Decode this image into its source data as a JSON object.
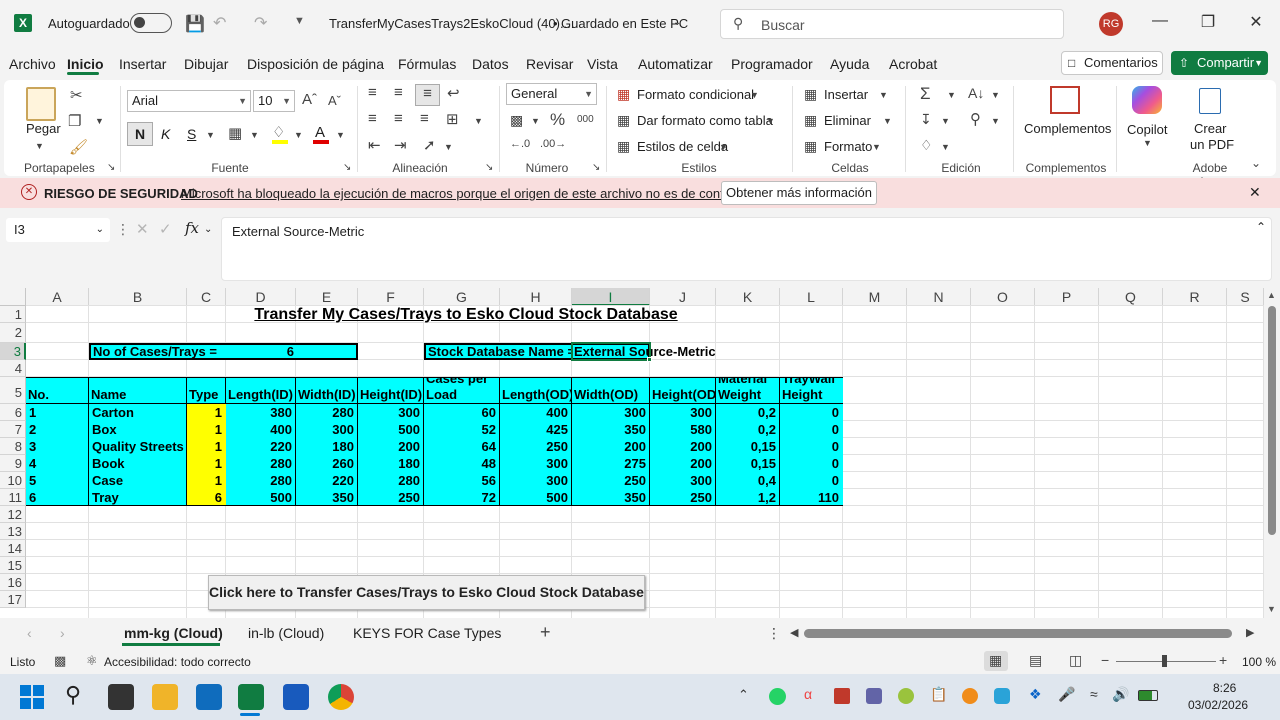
{
  "titlebar": {
    "autosave_label": "Autoguardado",
    "file_title": "TransferMyCasesTrays2EskoCloud (40)....",
    "save_status": "Guardado en Este PC",
    "search_placeholder": "Buscar",
    "user_initials": "RG"
  },
  "menu": {
    "tabs": [
      "Archivo",
      "Inicio",
      "Insertar",
      "Dibujar",
      "Disposición de página",
      "Fórmulas",
      "Datos",
      "Revisar",
      "Vista",
      "Automatizar",
      "Programador",
      "Ayuda",
      "Acrobat"
    ],
    "comments_label": "Comentarios",
    "share_label": "Compartir"
  },
  "ribbon": {
    "paste_label": "Pegar",
    "font_name": "Arial",
    "font_size": "10",
    "bold_label": "N",
    "italic_label": "K",
    "underline_label": "S",
    "number_format": "General",
    "cond_format": "Formato condicional",
    "format_table": "Dar formato como tabla",
    "cell_styles": "Estilos de celda",
    "insert_label": "Insertar",
    "delete_label": "Eliminar",
    "format_label": "Formato",
    "addins_label": "Complementos",
    "copilot_label": "Copilot",
    "create_pdf_line1": "Crear",
    "create_pdf_line2": "un PDF",
    "groups": {
      "clipboard": "Portapapeles",
      "font": "Fuente",
      "alignment": "Alineación",
      "number": "Número",
      "styles": "Estilos",
      "cells": "Celdas",
      "editing": "Edición",
      "addins": "Complementos",
      "adobe": "Adobe Ac..."
    }
  },
  "security": {
    "title": "RIESGO DE SEGURIDAD",
    "message": "Microsoft ha bloqueado la ejecución de macros porque el origen de este archivo no es de confianza.",
    "button": "Obtener más información"
  },
  "formula_bar": {
    "name_box": "I3",
    "fx": "fx",
    "content": "External Source-Metric"
  },
  "sheet": {
    "columns": [
      "A",
      "B",
      "C",
      "D",
      "E",
      "F",
      "G",
      "H",
      "I",
      "J",
      "K",
      "L",
      "M",
      "N",
      "O",
      "P",
      "Q",
      "R",
      "S"
    ],
    "rows": [
      "1",
      "2",
      "3",
      "4",
      "5",
      "6",
      "7",
      "8",
      "9",
      "10",
      "11",
      "12",
      "13",
      "14",
      "15",
      "16",
      "17"
    ],
    "title": "Transfer My Cases/Trays to Esko Cloud Stock Database",
    "cases_label": "No of Cases/Trays =",
    "cases_value": "6",
    "stock_label": "Stock Database Name =",
    "stock_value": "External Source-Metric",
    "headers": [
      "No.",
      "Name",
      "Type",
      "Length(ID)",
      "Width(ID)",
      "Height(ID)",
      "Cases per Load",
      "Length(OD)",
      "Width(OD)",
      "Height(OD)",
      "Material Weight",
      "TrayWall Height"
    ],
    "data": [
      [
        "1",
        "Carton",
        "1",
        "380",
        "280",
        "300",
        "60",
        "400",
        "300",
        "300",
        "0,2",
        "0"
      ],
      [
        "2",
        "Box",
        "1",
        "400",
        "300",
        "500",
        "52",
        "425",
        "350",
        "580",
        "0,2",
        "0"
      ],
      [
        "3",
        "Quality Streets",
        "1",
        "220",
        "180",
        "200",
        "64",
        "250",
        "200",
        "200",
        "0,15",
        "0"
      ],
      [
        "4",
        "Book",
        "1",
        "280",
        "260",
        "180",
        "48",
        "300",
        "275",
        "200",
        "0,15",
        "0"
      ],
      [
        "5",
        "Case",
        "1",
        "280",
        "220",
        "280",
        "56",
        "300",
        "250",
        "300",
        "0,4",
        "0"
      ],
      [
        "6",
        "Tray",
        "6",
        "500",
        "350",
        "250",
        "72",
        "500",
        "350",
        "250",
        "1,2",
        "110"
      ]
    ],
    "transfer_button": "Click here to Transfer Cases/Trays to Esko Cloud Stock Database"
  },
  "sheet_tabs": [
    "mm-kg (Cloud)",
    "in-lb (Cloud)",
    "KEYS FOR Case Types"
  ],
  "statusbar": {
    "ready": "Listo",
    "accessibility": "Accesibilidad: todo correcto",
    "zoom": "100 %"
  },
  "taskbar": {
    "time": "8:26",
    "date": "03/02/2026"
  }
}
